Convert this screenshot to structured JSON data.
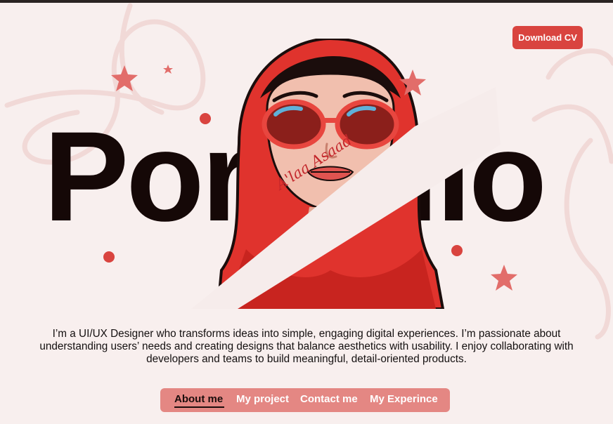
{
  "header": {
    "download_label": "Download CV"
  },
  "hero": {
    "title": "Portfolio",
    "signature": "A'laa Asaad"
  },
  "intro": {
    "text": "I’m a UI/UX Designer who transforms ideas into simple, engaging digital experiences. I’m passionate about understanding users’ needs and creating designs that balance aesthetics with usability. I enjoy collaborating with developers and teams to build meaningful, detail-oriented products."
  },
  "nav": {
    "items": [
      {
        "label": "About me",
        "active": true
      },
      {
        "label": "My project",
        "active": false
      },
      {
        "label": "Contact me",
        "active": false
      },
      {
        "label": "My Experince",
        "active": false
      }
    ]
  },
  "colors": {
    "accent": "#d9443f",
    "nav_bg": "#e48783",
    "background": "#f8efee",
    "text": "#150807"
  }
}
